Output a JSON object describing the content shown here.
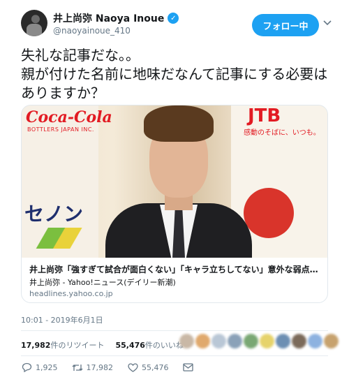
{
  "user": {
    "display_name": "井上尚弥 Naoya Inoue",
    "handle": "@naoyainoue_410",
    "verified_icon": "verified-badge-icon",
    "follow_label": "フォロー中"
  },
  "tweet": {
    "text": "失礼な記事だな。。\n親が付けた名前に地味だなんて記事にする必要はありますか？"
  },
  "card": {
    "image_texts": {
      "coke": "Coca-Cola",
      "coke_sub": "BOTTLERS JAPAN INC.",
      "jtb": "JTB",
      "jtb_sub": "感動のそばに、いつも。",
      "senon": "セノン"
    },
    "title": "井上尚弥「強すぎて試合が面白くない」「キャラ立ちしてない」意外な弱点（デ...",
    "description": "井上尚弥 - Yahoo!ニュース(デイリー新潮)",
    "domain": "headlines.yahoo.co.jp"
  },
  "timestamp": "10:01 - 2019年6月1日",
  "stats": {
    "retweets_count": "17,982",
    "retweets_label": "件のリツイート",
    "likes_count": "55,476",
    "likes_label": "件のいいね"
  },
  "likers_colors": [
    "#c9b8a6",
    "#e0a96d",
    "#b9c7d6",
    "#8aa1b8",
    "#7aa874",
    "#e6d36b",
    "#6d8fb3",
    "#7b6a5a",
    "#8db2e0",
    "#c7a26e"
  ],
  "actions": {
    "reply_count": "1,925",
    "retweet_count": "17,982",
    "like_count": "55,476"
  },
  "colors": {
    "accent": "#1da1f2",
    "muted_text": "#657786"
  }
}
